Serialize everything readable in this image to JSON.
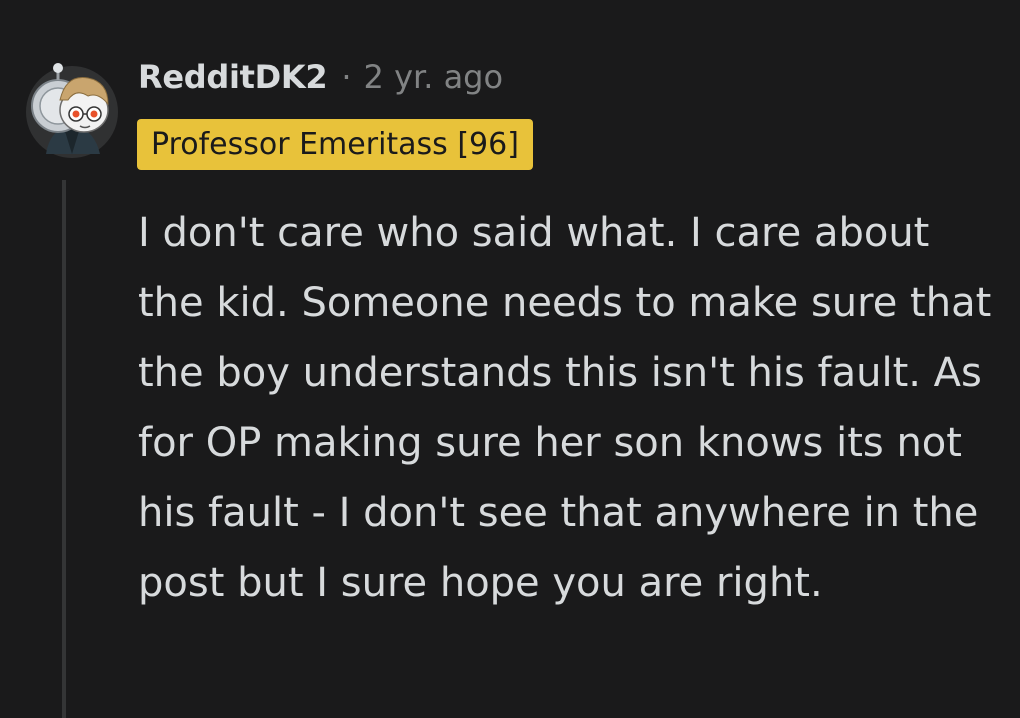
{
  "comment": {
    "author": "RedditDK2",
    "separator": "·",
    "timestamp": "2 yr. ago",
    "flair": "Professor Emeritass [96]",
    "body": "I don't care who said what. I care about the kid. Someone needs to make sure that the boy understands this isn't his fault. As for OP making sure her son knows its not his fault - I don't see that anywhere in the post but I sure hope you are right."
  },
  "colors": {
    "background": "#1a1a1b",
    "text": "#d7dadc",
    "muted": "#818384",
    "flair_bg": "#e8c23a",
    "flair_text": "#1a1a1b",
    "thread_line": "#343536"
  },
  "icons": {
    "avatar": "avatar-icon"
  }
}
